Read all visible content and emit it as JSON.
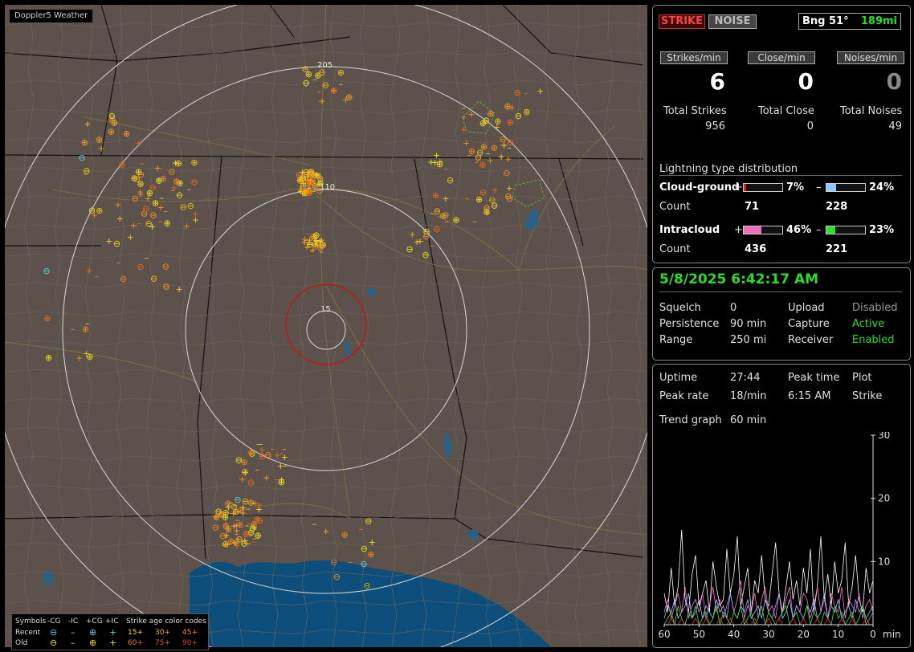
{
  "map": {
    "brand": "Doppler5 Weather",
    "range_labels": [
      "205",
      "110",
      "15"
    ]
  },
  "legend": {
    "symbols_label": "Symbols",
    "col_ncg": "-CG",
    "col_nic": "-IC",
    "col_pcg": "+CG",
    "col_pic": "+IC",
    "recent_label": "Recent",
    "old_label": "Old",
    "age_title": "Strike age color codes",
    "age_recent": [
      "15+",
      "30+",
      "45+"
    ],
    "age_old": [
      "60+",
      "75+",
      "90+"
    ]
  },
  "status": {
    "strike_btn": "STRIKE",
    "noise_btn": "NOISE",
    "bearing": "Bng 51°",
    "distance": "189mi"
  },
  "rates": {
    "strikes_label": "Strikes/min",
    "strikes_value": "6",
    "close_label": "Close/min",
    "close_value": "0",
    "noises_label": "Noises/min",
    "noises_value": "0"
  },
  "totals": {
    "strikes_label": "Total Strikes",
    "strikes_value": "956",
    "close_label": "Total Close",
    "close_value": "0",
    "noises_label": "Total Noises",
    "noises_value": "49"
  },
  "distribution": {
    "title": "Lightning type distribution",
    "cg_label": "Cloud-ground",
    "cg_plus_pct": "7%",
    "cg_minus_pct": "24%",
    "cg_plus_fill": 7,
    "cg_minus_fill": 24,
    "count_label": "Count",
    "cg_plus_count": "71",
    "cg_minus_count": "228",
    "ic_label": "Intracloud",
    "ic_plus_pct": "46%",
    "ic_minus_pct": "23%",
    "ic_plus_fill": 46,
    "ic_minus_fill": 23,
    "ic_plus_count": "436",
    "ic_minus_count": "221",
    "plus_sign": "+",
    "minus_sign": "–"
  },
  "settings": {
    "datetime": "5/8/2025 6:42:17 AM",
    "squelch_label": "Squelch",
    "squelch_value": "0",
    "persistence_label": "Persistence",
    "persistence_value": "90 min",
    "range_label": "Range",
    "range_value": "250 mi",
    "upload_label": "Upload",
    "upload_value": "Disabled",
    "capture_label": "Capture",
    "capture_value": "Active",
    "receiver_label": "Receiver",
    "receiver_value": "Enabled"
  },
  "stats": {
    "uptime_label": "Uptime",
    "uptime_value": "27:44",
    "peak_time_label": "Peak time",
    "peak_time_value": "6:15 AM",
    "plot_label": "Plot",
    "plot_value": "Strike",
    "peak_rate_label": "Peak rate",
    "peak_rate_value": "18/min",
    "trend_label": "Trend graph",
    "trend_value": "60 min"
  },
  "chart_data": {
    "type": "line",
    "x_ticks": [
      "60",
      "50",
      "40",
      "30",
      "20",
      "10",
      "0"
    ],
    "x_unit": "min",
    "y_ticks": [
      "30",
      "20",
      "10"
    ],
    "ylim": [
      0,
      30
    ],
    "xlim": [
      60,
      0
    ],
    "series": [
      {
        "color": "#ffffff",
        "values": [
          5,
          2,
          9,
          3,
          6,
          15,
          4,
          2,
          8,
          11,
          3,
          5,
          7,
          2,
          10,
          6,
          3,
          4,
          12,
          5,
          8,
          14,
          3,
          6,
          9,
          2,
          7,
          5,
          11,
          4,
          3,
          8,
          13,
          5,
          2,
          6,
          10,
          4,
          7,
          3,
          9,
          5,
          12,
          2,
          6,
          14,
          4,
          8,
          3,
          10,
          5,
          7,
          13,
          3,
          6,
          11,
          4,
          2,
          9,
          5,
          7
        ]
      },
      {
        "color": "#ff70c8",
        "values": [
          2,
          4,
          1,
          3,
          5,
          2,
          6,
          1,
          3,
          4,
          2,
          5,
          1,
          3,
          6,
          2,
          4,
          1,
          3,
          5,
          2,
          4,
          7,
          1,
          3,
          2,
          5,
          1,
          4,
          6,
          2,
          3,
          1,
          5,
          2,
          4,
          6,
          1,
          3,
          2,
          5,
          4,
          1,
          3,
          6,
          2,
          4,
          1,
          5,
          3,
          2,
          6,
          1,
          4,
          3,
          2,
          5,
          1,
          3,
          4,
          2
        ]
      },
      {
        "color": "#8ec8ff",
        "values": [
          1,
          3,
          2,
          4,
          1,
          2,
          3,
          5,
          1,
          2,
          4,
          1,
          3,
          2,
          1,
          4,
          2,
          3,
          1,
          5,
          2,
          1,
          3,
          2,
          4,
          1,
          2,
          3,
          1,
          4,
          2,
          1,
          3,
          5,
          1,
          2,
          4,
          1,
          3,
          2,
          1,
          3,
          2,
          4,
          1,
          2,
          5,
          1,
          3,
          2,
          4,
          1,
          2,
          3,
          1,
          4,
          2,
          3,
          1,
          2,
          3
        ]
      },
      {
        "color": "#40e040",
        "values": [
          0,
          1,
          2,
          0,
          3,
          1,
          0,
          2,
          1,
          3,
          0,
          1,
          2,
          0,
          1,
          3,
          0,
          2,
          1,
          0,
          2,
          1,
          3,
          0,
          1,
          2,
          0,
          1,
          3,
          0,
          2,
          1,
          0,
          1,
          2,
          3,
          0,
          1,
          2,
          0,
          1,
          3,
          0,
          2,
          1,
          0,
          2,
          1,
          0,
          3,
          1,
          2,
          0,
          1,
          2,
          0,
          1,
          3,
          0,
          1,
          2
        ]
      },
      {
        "color": "#ff3030",
        "values": [
          0,
          0,
          1,
          0,
          0,
          1,
          0,
          0,
          0,
          1,
          0,
          0,
          1,
          0,
          0,
          0,
          1,
          0,
          0,
          1,
          0,
          0,
          0,
          1,
          0,
          0,
          1,
          0,
          0,
          0,
          1,
          0,
          0,
          1,
          0,
          0,
          0,
          1,
          0,
          0,
          1,
          0,
          0,
          0,
          1,
          0,
          0,
          1,
          0,
          0,
          0,
          1,
          0,
          0,
          1,
          0,
          0,
          0,
          1,
          0,
          0
        ]
      }
    ]
  }
}
